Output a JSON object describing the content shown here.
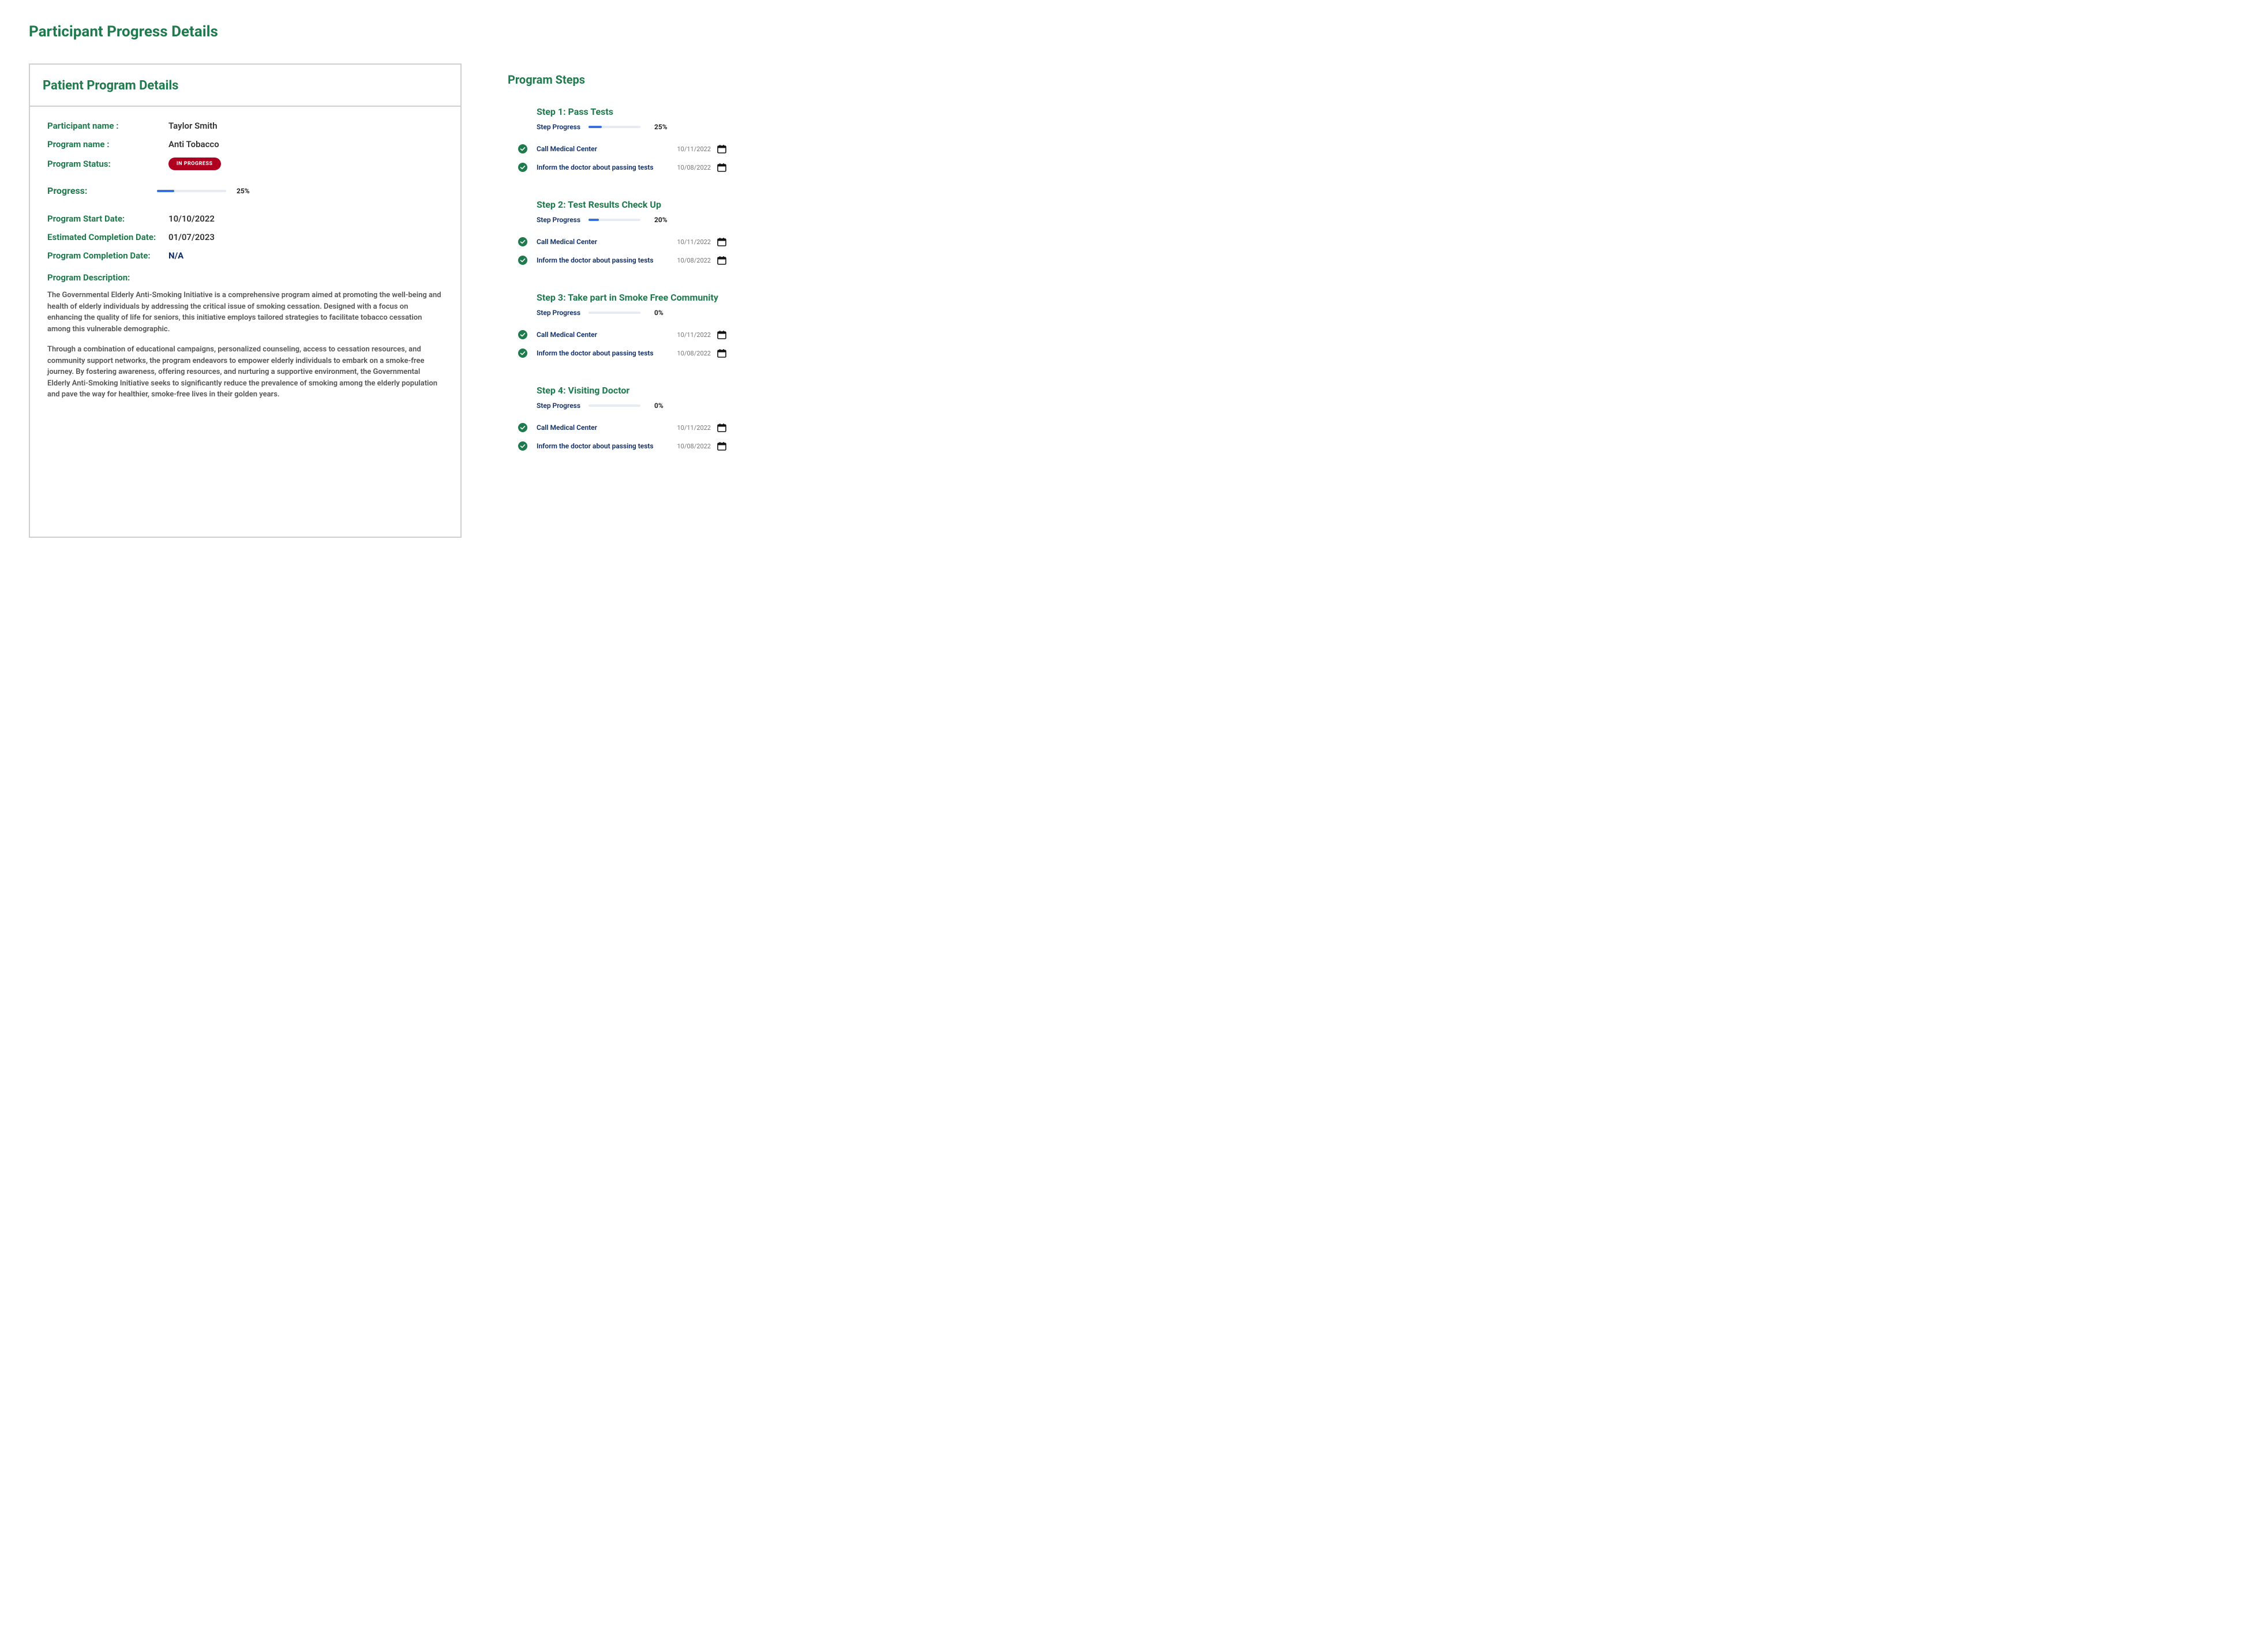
{
  "page_title": "Participant Progress Details",
  "details_header": "Patient Program Details",
  "fields": {
    "participant_label": "Participant name :",
    "participant_value": "Taylor Smith",
    "program_label": "Program name :",
    "program_value": "Anti Tobacco",
    "status_label": "Program Status:",
    "status_value": "IN PROGRESS",
    "progress_label": "Progress:",
    "progress_pct_text": "25%",
    "progress_pct_width": "25%",
    "start_label": "Program Start Date:",
    "start_value": "10/10/2022",
    "est_label": "Estimated Completion Date:",
    "est_value": "01/07/2023",
    "complete_label": "Program Completion Date:",
    "complete_value": "N/A",
    "desc_label": "Program Description:",
    "desc_p1": "The Governmental Elderly Anti-Smoking Initiative is a comprehensive program aimed at promoting the well-being and health of elderly individuals by addressing the critical issue of smoking cessation. Designed with a focus on enhancing the quality of life for seniors, this initiative employs tailored strategies to facilitate tobacco cessation among this vulnerable demographic.",
    "desc_p2": "Through a combination of educational campaigns, personalized counseling, access to cessation resources, and community support networks, the program endeavors to empower elderly individuals to embark on a smoke-free journey. By fostering awareness, offering resources, and nurturing a supportive environment, the Governmental Elderly Anti-Smoking Initiative seeks to significantly reduce the prevalence of smoking among the elderly population and pave the way for healthier, smoke-free lives in their golden years."
  },
  "steps_header": "Program Steps",
  "step_progress_label": "Step Progress",
  "steps": [
    {
      "title": "Step 1: Pass Tests",
      "pct_text": "25%",
      "pct_width": "25%",
      "tasks": [
        {
          "text": "Call Medical Center",
          "date": "10/11/2022"
        },
        {
          "text": "Inform the doctor about passing tests",
          "date": "10/08/2022"
        }
      ]
    },
    {
      "title": "Step 2: Test Results Check Up",
      "pct_text": "20%",
      "pct_width": "20%",
      "tasks": [
        {
          "text": "Call Medical Center",
          "date": "10/11/2022"
        },
        {
          "text": "Inform the doctor about passing tests",
          "date": "10/08/2022"
        }
      ]
    },
    {
      "title": "Step 3: Take part in Smoke Free Community",
      "pct_text": "0%",
      "pct_width": "0%",
      "tasks": [
        {
          "text": "Call Medical Center",
          "date": "10/11/2022"
        },
        {
          "text": "Inform the doctor about passing tests",
          "date": "10/08/2022"
        }
      ]
    },
    {
      "title": "Step 4: Visiting Doctor",
      "pct_text": "0%",
      "pct_width": "0%",
      "tasks": [
        {
          "text": "Call Medical Center",
          "date": "10/11/2022"
        },
        {
          "text": "Inform the doctor about passing tests",
          "date": "10/08/2022"
        }
      ]
    }
  ]
}
